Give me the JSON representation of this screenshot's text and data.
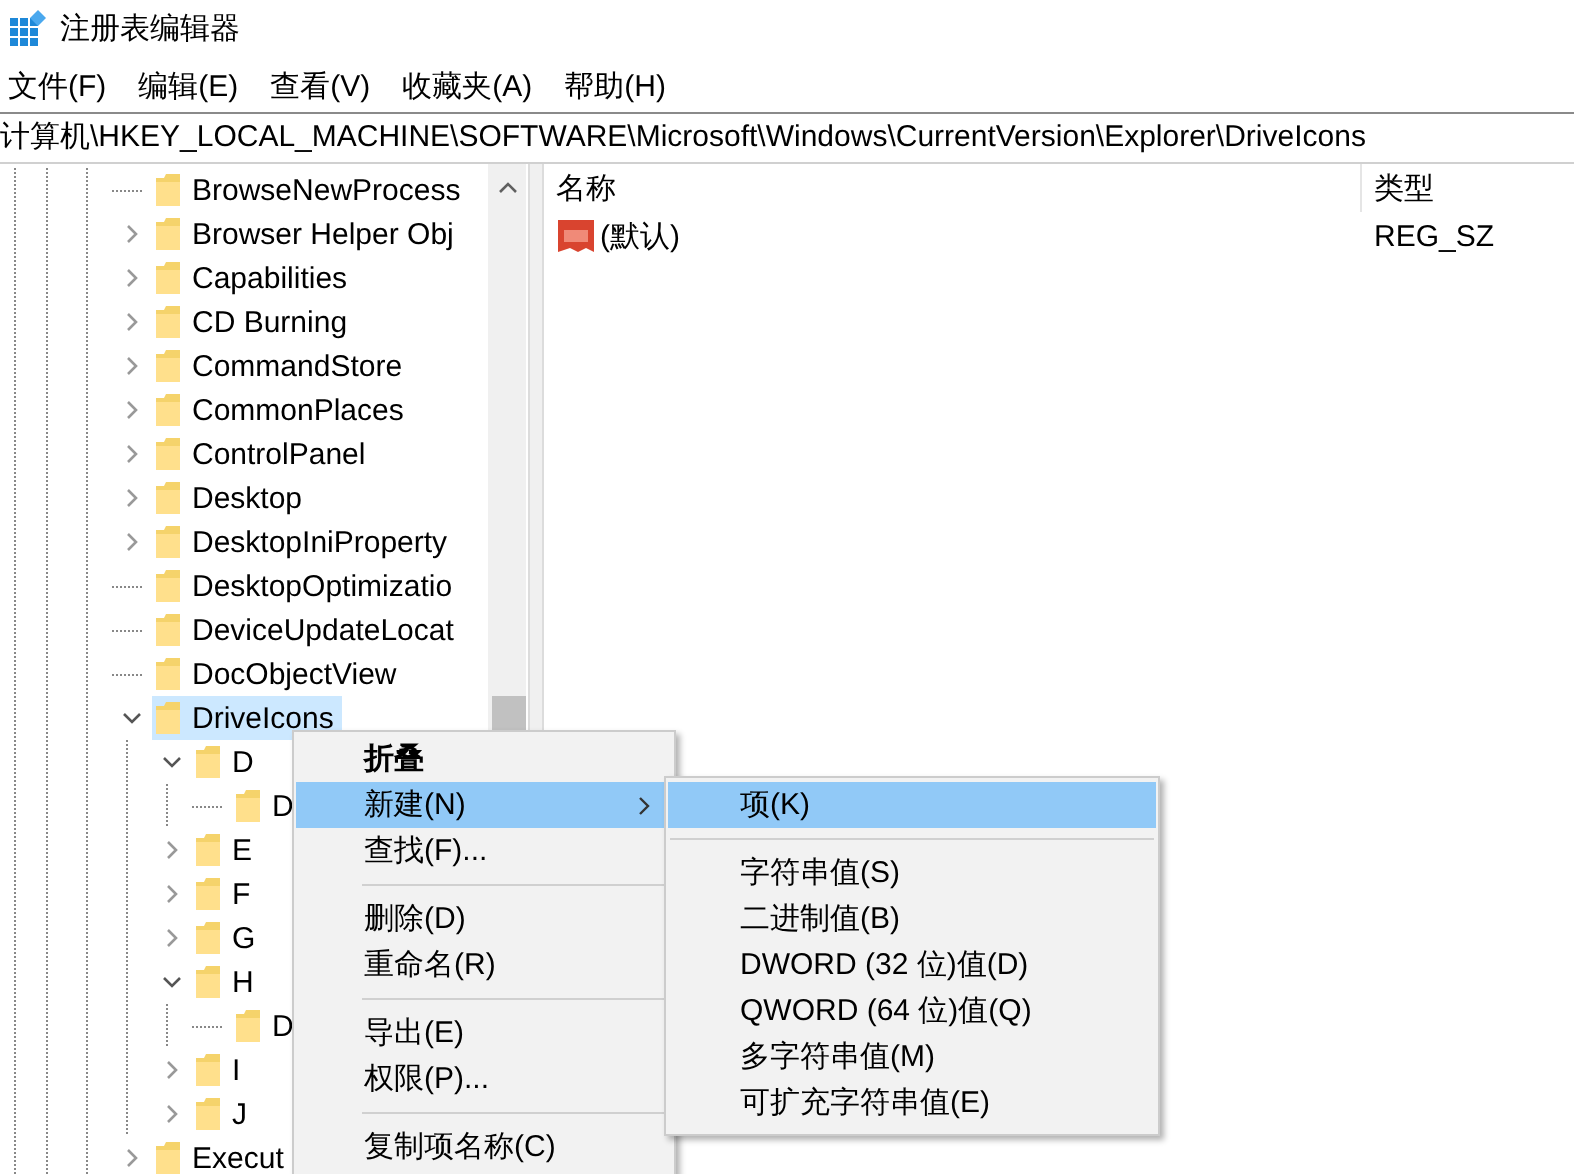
{
  "window": {
    "title": "注册表编辑器"
  },
  "menu_bar": [
    "文件(F)",
    "编辑(E)",
    "查看(V)",
    "收藏夹(A)",
    "帮助(H)"
  ],
  "address": "计算机\\HKEY_LOCAL_MACHINE\\SOFTWARE\\Microsoft\\Windows\\CurrentVersion\\Explorer\\DriveIcons",
  "tree": [
    {
      "label": "BrowseNewProcess",
      "kind": "leaf",
      "selected": false
    },
    {
      "label": "Browser Helper Obj",
      "kind": "branch",
      "expanded": false,
      "selected": false
    },
    {
      "label": "Capabilities",
      "kind": "branch",
      "expanded": false,
      "selected": false
    },
    {
      "label": "CD Burning",
      "kind": "branch",
      "expanded": false,
      "selected": false
    },
    {
      "label": "CommandStore",
      "kind": "branch",
      "expanded": false,
      "selected": false
    },
    {
      "label": "CommonPlaces",
      "kind": "branch",
      "expanded": false,
      "selected": false
    },
    {
      "label": "ControlPanel",
      "kind": "branch",
      "expanded": false,
      "selected": false
    },
    {
      "label": "Desktop",
      "kind": "branch",
      "expanded": false,
      "selected": false
    },
    {
      "label": "DesktopIniProperty",
      "kind": "branch",
      "expanded": false,
      "selected": false
    },
    {
      "label": "DesktopOptimizatio",
      "kind": "leaf",
      "selected": false
    },
    {
      "label": "DeviceUpdateLocat",
      "kind": "leaf",
      "selected": false
    },
    {
      "label": "DocObjectView",
      "kind": "leaf",
      "selected": false
    },
    {
      "label": "DriveIcons",
      "kind": "branch",
      "expanded": true,
      "selected": true,
      "children": [
        {
          "label": "D",
          "kind": "branch",
          "expanded": true,
          "selected": false,
          "children": [
            {
              "label": "D",
              "kind": "leaf",
              "selected": false
            }
          ]
        },
        {
          "label": "E",
          "kind": "branch",
          "expanded": false,
          "selected": false
        },
        {
          "label": "F",
          "kind": "branch",
          "expanded": false,
          "selected": false
        },
        {
          "label": "G",
          "kind": "branch",
          "expanded": false,
          "selected": false
        },
        {
          "label": "H",
          "kind": "branch",
          "expanded": true,
          "selected": false,
          "children": [
            {
              "label": "D",
              "kind": "leaf",
              "selected": false
            }
          ]
        },
        {
          "label": "I",
          "kind": "branch",
          "expanded": false,
          "selected": false
        },
        {
          "label": "J",
          "kind": "branch",
          "expanded": false,
          "selected": false
        }
      ]
    },
    {
      "label": "Execut",
      "kind": "branch",
      "expanded": false,
      "selected": false
    }
  ],
  "values": {
    "columns": [
      "名称",
      "类型"
    ],
    "rows": [
      {
        "name": "(默认)",
        "type": "REG_SZ"
      }
    ]
  },
  "context_menu": [
    {
      "kind": "item",
      "label": "折叠",
      "default": true,
      "selected": false
    },
    {
      "kind": "item",
      "label": "新建(N)",
      "has_submenu": true,
      "selected": true
    },
    {
      "kind": "item",
      "label": "查找(F)...",
      "selected": false
    },
    {
      "kind": "separator"
    },
    {
      "kind": "item",
      "label": "删除(D)",
      "selected": false
    },
    {
      "kind": "item",
      "label": "重命名(R)",
      "selected": false
    },
    {
      "kind": "separator"
    },
    {
      "kind": "item",
      "label": "导出(E)",
      "selected": false
    },
    {
      "kind": "item",
      "label": "权限(P)...",
      "selected": false
    },
    {
      "kind": "separator"
    },
    {
      "kind": "item",
      "label": "复制项名称(C)",
      "selected": false
    }
  ],
  "submenu": [
    {
      "kind": "item",
      "label": "项(K)",
      "selected": true
    },
    {
      "kind": "separator"
    },
    {
      "kind": "item",
      "label": "字符串值(S)",
      "selected": false
    },
    {
      "kind": "item",
      "label": "二进制值(B)",
      "selected": false
    },
    {
      "kind": "item",
      "label": "DWORD (32 位)值(D)",
      "selected": false
    },
    {
      "kind": "item",
      "label": "QWORD (64 位)值(Q)",
      "selected": false
    },
    {
      "kind": "item",
      "label": "多字符串值(M)",
      "selected": false
    },
    {
      "kind": "item",
      "label": "可扩充字符串值(E)",
      "selected": false
    }
  ]
}
